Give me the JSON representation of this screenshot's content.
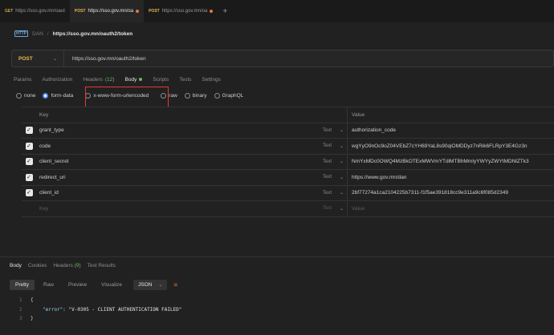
{
  "tabs": [
    {
      "method": "GET",
      "label": "https://sso.gov.mn/oaut",
      "active": false,
      "dirty": false,
      "close": ""
    },
    {
      "method": "POST",
      "label": "https://sso.gov.mn/oa",
      "active": true,
      "dirty": true,
      "close": ""
    },
    {
      "method": "POST",
      "label": "https://sso.gov.mn/oa",
      "active": false,
      "dirty": true,
      "close": ""
    }
  ],
  "new_tab": "+",
  "breadcrumb": {
    "icon": "HTTP",
    "collection": "DAN",
    "separator": "/",
    "url": "https://sso.gov.mn/oauth2/token"
  },
  "request": {
    "method": "POST",
    "url": "https://sso.gov.mn/oauth2/token"
  },
  "request_tabs": {
    "params": "Params",
    "authorization": "Authorization",
    "headers": "Headers",
    "headers_count": "(12)",
    "body": "Body",
    "scripts": "Scripts",
    "tests": "Tests",
    "settings": "Settings"
  },
  "body_types": {
    "none": "none",
    "form_data": "form-data",
    "urlencoded": "x-www-form-urlencoded",
    "raw": "raw",
    "binary": "binary",
    "graphql": "GraphQL"
  },
  "table": {
    "headers": {
      "key": "Key",
      "value": "Value"
    },
    "rows": [
      {
        "key": "grant_type",
        "type": "Text",
        "value": "authorization_code"
      },
      {
        "key": "code",
        "type": "Text",
        "value": "wgYyO9nOc9oZ04VEbZ7cYH69YaL8s90qiOMDDyz7nRik6FLRpY3E4Gz3n"
      },
      {
        "key": "client_secret",
        "type": "Text",
        "value": "NmYxMDc0OWQ4MzBkOTExMWVmYTdlMTBhMmIyYWYyZWYtMDNlZTk3"
      },
      {
        "key": "redirect_uri",
        "type": "Text",
        "value": "https://www.gov.mn/dan"
      },
      {
        "key": "client_id",
        "type": "Text",
        "value": "2bf77274a1ca2104225b7311-f1f5ae391818cc9e311a9c6f085d2349"
      }
    ],
    "placeholder": {
      "key": "Key",
      "type": "Text",
      "value": "Value"
    }
  },
  "response_tabs": {
    "body": "Body",
    "cookies": "Cookies",
    "headers": "Headers",
    "headers_count": "(9)",
    "test_results": "Test Results"
  },
  "format": {
    "pretty": "Pretty",
    "raw": "Raw",
    "preview": "Preview",
    "visualize": "Visualize",
    "lang": "JSON"
  },
  "response": {
    "line_numbers": [
      "1",
      "2",
      "3"
    ],
    "open": "{",
    "close": "}",
    "key": "\"error\"",
    "colon": ": ",
    "value": "\"V-0305 - CLIENT AUTHENTICATION FAILED\""
  },
  "colors": {
    "accent": "#5b8def",
    "post": "#e8b84a",
    "highlight": "#e53935",
    "success": "#66bb6a"
  }
}
